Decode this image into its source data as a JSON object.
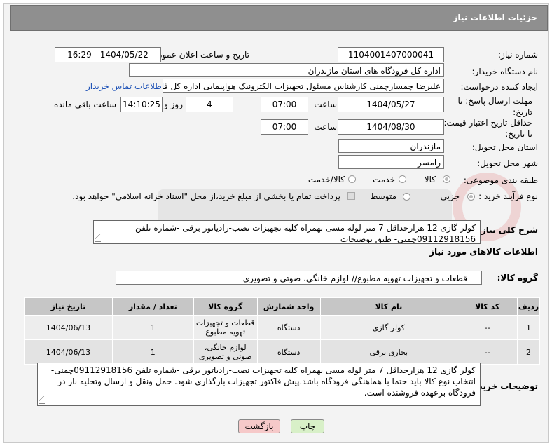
{
  "header": {
    "title": "جزئیات اطلاعات نیاز"
  },
  "fields": {
    "need_number_label": "شماره نیاز:",
    "need_number": "1104001407000041",
    "announce_label": "تاریخ و ساعت اعلان عمومی:",
    "announce_value": "1404/05/22 - 16:29",
    "buyer_org_label": "نام دستگاه خریدار:",
    "buyer_org": "اداره کل فرودگاه های استان مازندران",
    "creator_label": "ایجاد کننده درخواست:",
    "creator": "علیرضا چمسارچمنی کارشناس مسئول تجهیزات الکترونیک هواپیمایی اداره کل فرودگاه",
    "contact_link": "اطلاعات تماس خریدار",
    "reply_deadline_label": "مهلت ارسال پاسخ: تا تاریخ:",
    "reply_date": "1404/05/27",
    "time_label": "ساعت",
    "reply_time": "07:00",
    "days_value": "4",
    "days_label": "روز و",
    "remaining_time": "14:10:25",
    "remaining_label": "ساعت باقی مانده",
    "validity_label": "حداقل تاریخ اعتبار قیمت: تا تاریخ:",
    "validity_date": "1404/08/30",
    "validity_time": "07:00",
    "province_label": "استان محل تحویل:",
    "province": "مازندران",
    "city_label": "شهر محل تحویل:",
    "city": "رامسر",
    "category_label": "طبقه بندی موضوعی:",
    "category_options": [
      "کالا",
      "خدمت",
      "کالا/خدمت"
    ],
    "process_label": "نوع فرآیند خرید :",
    "process_options": [
      "جزیی",
      "متوسط"
    ],
    "process_note": "پرداخت تمام یا بخشی از مبلغ خرید،از محل \"اسناد خزانه اسلامی\" خواهد بود.",
    "summary_label": "شرح کلی نیاز:",
    "summary_text": "کولر گازی 12 هزارحداقل 7 متر لوله مسی بهمراه کلیه تجهیزات نصب-رادیاتور برقی -شماره تلفن 09112918156چمنی- طبق توضیحات",
    "goods_info_title": "اطلاعات کالاهای مورد نیاز",
    "goods_group_label": "گروه کالا:",
    "goods_group": "قطعات و تجهیزات تهویه مطبوع// لوازم خانگی، صوتی و تصویری"
  },
  "table": {
    "headers": [
      "ردیف",
      "کد کالا",
      "نام کالا",
      "واحد شمارش",
      "گروه کالا",
      "تعداد / مقدار",
      "تاریخ نیاز"
    ],
    "rows": [
      {
        "row": "1",
        "code": "--",
        "name": "کولر گازی",
        "unit": "دستگاه",
        "group": "قطعات و تجهیزات تهویه مطبوع",
        "qty": "1",
        "date": "1404/06/13"
      },
      {
        "row": "2",
        "code": "--",
        "name": "بخاری برقی",
        "unit": "دستگاه",
        "group": "لوازم خانگی، صوتی و تصویری",
        "qty": "1",
        "date": "1404/06/13"
      }
    ]
  },
  "buyer_notes_label": "توضیحات خریدار:",
  "buyer_notes": "کولر گازی 12 هزارحداقل 7 متر لوله مسی بهمراه کلیه تجهیزات نصب-رادیاتور برقی -شماره تلفن 09112918156چمنی-انتخاب نوع کالا باید حتما با هماهنگی فرودگاه باشد.پیش فاکتور تجهیزات بارگذاری شود. حمل ونقل و ارسال وتخلیه بار در فرودگاه برعهده فروشنده است.",
  "buttons": {
    "print": "چاپ",
    "back": "بازگشت"
  },
  "colors": {
    "title_bg": "#8f8f8f",
    "print_btn": "#d8f0c8",
    "back_btn": "#f6c9c9",
    "link": "#1a4fb5"
  }
}
